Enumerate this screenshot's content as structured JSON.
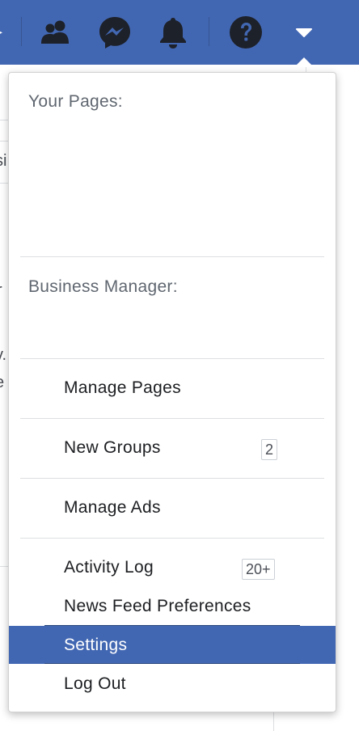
{
  "colors": {
    "topbar": "#4267b2",
    "active_item": "#4267b2",
    "icon": "#1d2129",
    "text": "#1c1e21",
    "heading": "#606770",
    "separator": "#dddfe2"
  },
  "topbar": {
    "icons": [
      {
        "name": "friend-requests-icon"
      },
      {
        "name": "messenger-icon"
      },
      {
        "name": "notifications-bell-icon"
      },
      {
        "name": "help-question-icon"
      },
      {
        "name": "account-menu-caret-icon"
      }
    ]
  },
  "background_fragments": {
    "frag1": "si",
    "frag2": "r",
    "frag3": "v.",
    "frag4": "e"
  },
  "dropdown": {
    "sections": {
      "your_pages": "Your Pages:",
      "business_manager": "Business Manager:"
    },
    "items": {
      "manage_pages": {
        "label": "Manage Pages"
      },
      "new_groups": {
        "label": "New Groups",
        "badge": "2"
      },
      "manage_ads": {
        "label": "Manage Ads"
      },
      "activity_log": {
        "label": "Activity Log",
        "badge": "20+"
      },
      "news_feed_preferences": {
        "label": "News Feed Preferences"
      },
      "settings": {
        "label": "Settings",
        "selected": true
      },
      "log_out": {
        "label": "Log Out"
      }
    }
  }
}
